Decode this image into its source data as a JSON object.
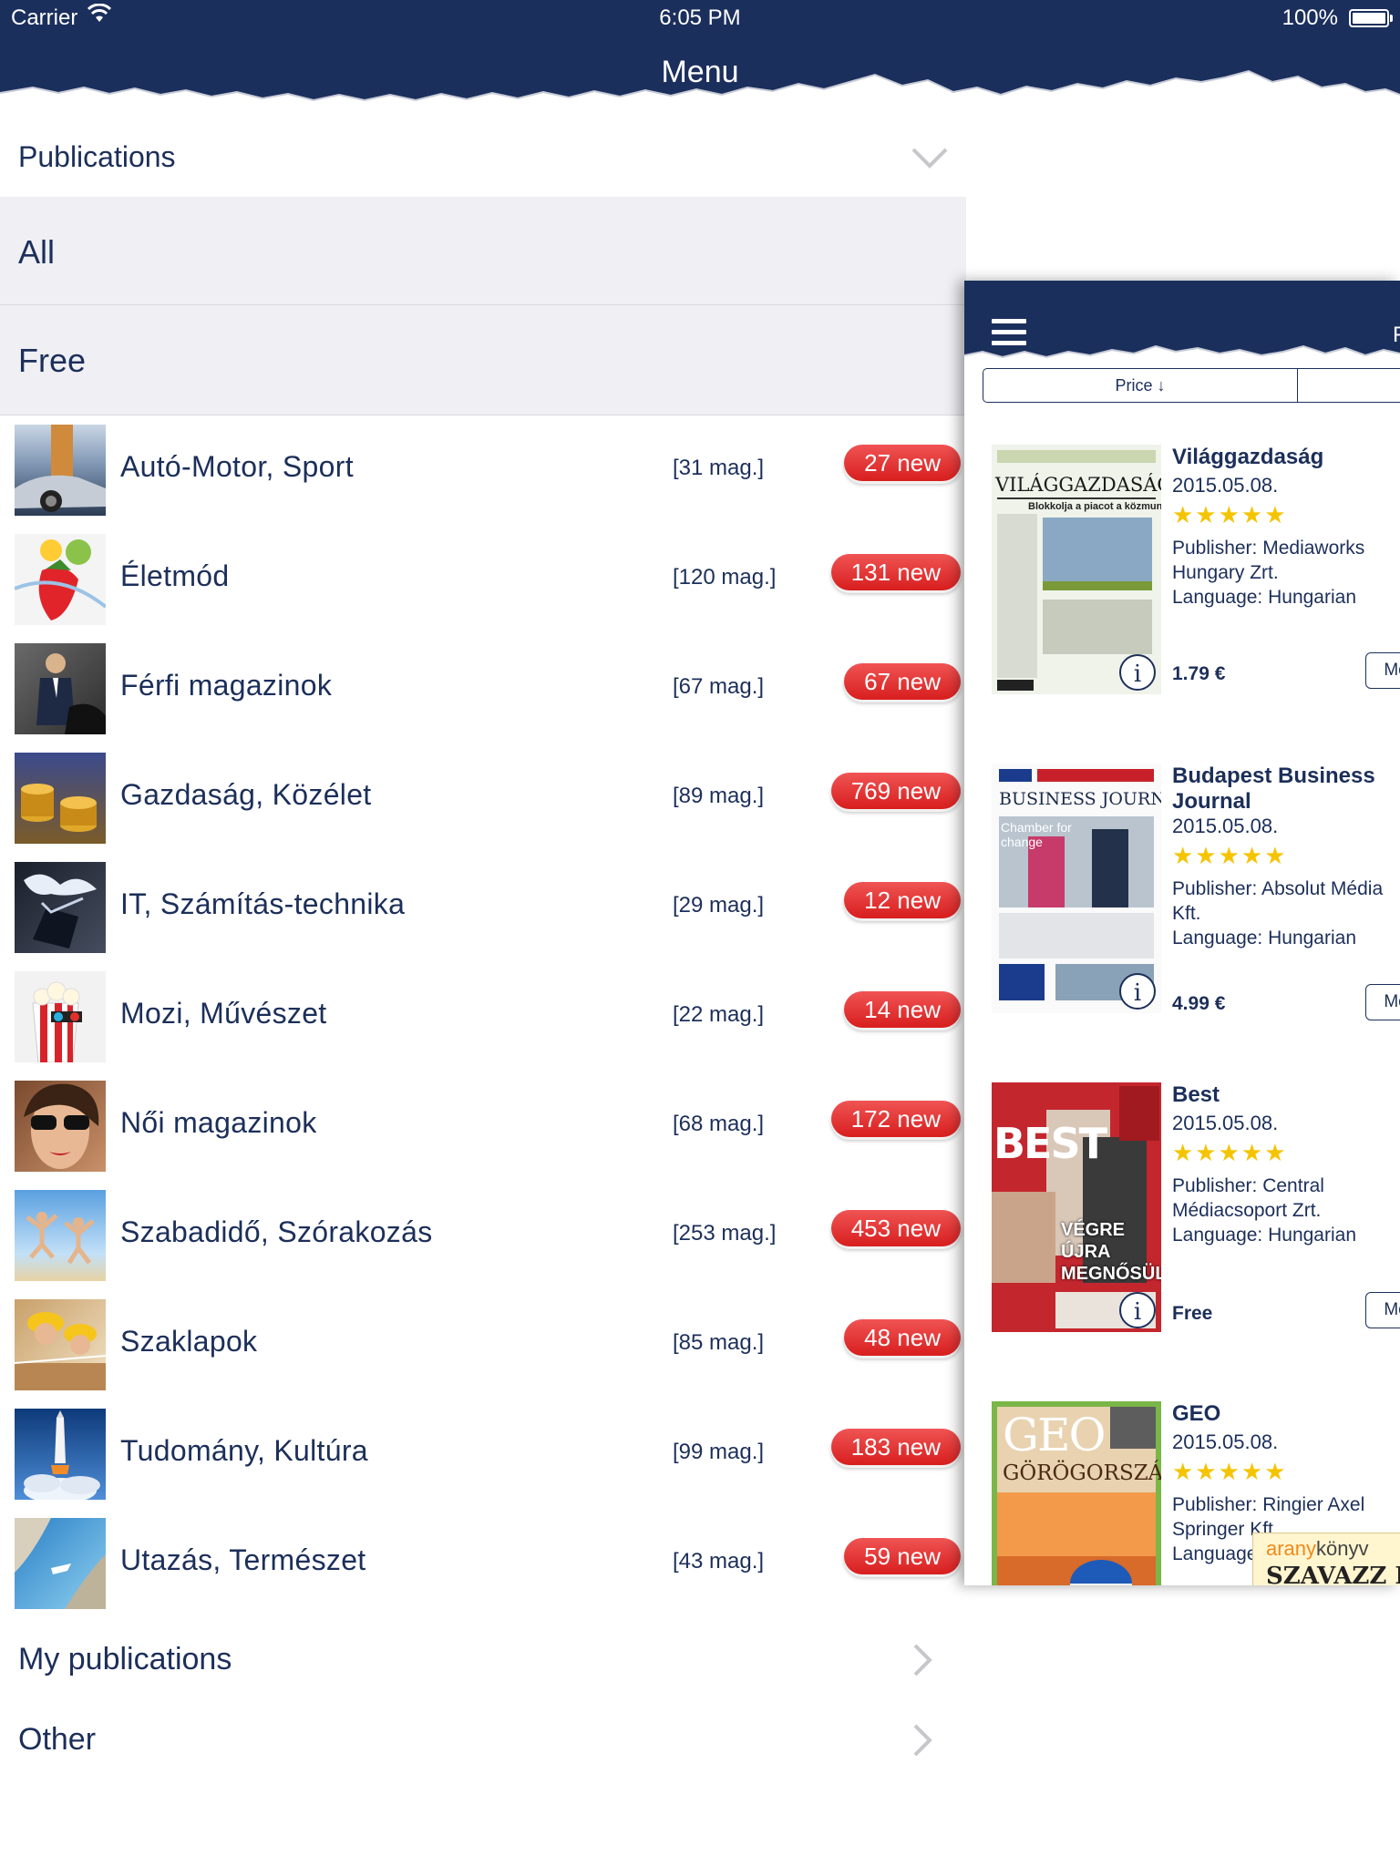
{
  "status_bar": {
    "carrier": "Carrier",
    "time": "6:05 PM",
    "battery": "100%"
  },
  "nav": {
    "title": "Menu"
  },
  "publications_section": {
    "title": "Publications"
  },
  "filters": [
    "All",
    "Free"
  ],
  "categories": [
    {
      "name": "Autó-Motor, Sport",
      "count": "[31 mag.]",
      "badge": "27 new"
    },
    {
      "name": "Életmód",
      "count": "[120 mag.]",
      "badge": "131 new"
    },
    {
      "name": "Férfi magazinok",
      "count": "[67 mag.]",
      "badge": "67 new"
    },
    {
      "name": "Gazdaság, Közélet",
      "count": "[89 mag.]",
      "badge": "769 new"
    },
    {
      "name": "IT, Számítás-technika",
      "count": "[29 mag.]",
      "badge": "12 new"
    },
    {
      "name": "Mozi, Művészet",
      "count": "[22 mag.]",
      "badge": "14 new"
    },
    {
      "name": "Női magazinok",
      "count": "[68 mag.]",
      "badge": "172 new"
    },
    {
      "name": "Szabadidő, Szórakozás",
      "count": "[253 mag.]",
      "badge": "453 new"
    },
    {
      "name": "Szaklapok",
      "count": "[85 mag.]",
      "badge": "48 new"
    },
    {
      "name": "Tudomány, Kultúra",
      "count": "[99 mag.]",
      "badge": "183 new"
    },
    {
      "name": "Utazás, Természet",
      "count": "[43 mag.]",
      "badge": "59 new"
    }
  ],
  "bottom_items": [
    "My publications",
    "Other"
  ],
  "panel": {
    "title_fragment": "F",
    "sort_label": "Price ↓",
    "more_label": "More",
    "items": [
      {
        "title": "Világgazdaság",
        "date": "2015.05.08.",
        "stars": "★★★★★",
        "publisher": "Publisher: Mediaworks Hungary Zrt.",
        "language": "Language: Hungarian",
        "price": "1.79 €",
        "cover": {
          "masthead": "VILÁGGAZDASÁG",
          "headline": "Blokkolja a piacot a közmunka"
        }
      },
      {
        "title": "Budapest Business Journal",
        "date": "2015.05.08.",
        "stars": "★★★★★",
        "publisher": "Publisher: Absolut Média Kft.",
        "language": "Language: Hungarian",
        "price": "4.99 €",
        "cover": {
          "masthead": "BUSINESS JOURNAL",
          "headline": "Chamber for change"
        }
      },
      {
        "title": "Best",
        "date": "2015.05.08.",
        "stars": "★★★★★",
        "publisher": "Publisher: Central Médiacsoport Zrt.",
        "language": "Language: Hungarian",
        "price": "Free",
        "cover": {
          "masthead": "BEST",
          "headline": "VÉGRE ÚJRA MEGNŐSÜL!"
        }
      },
      {
        "title": "GEO",
        "date": "2015.05.08.",
        "stars": "★★★★★",
        "publisher": "Publisher: Ringier Axel Springer Kft.",
        "language": "Language: Hungarian",
        "price": "",
        "cover": {
          "masthead": "GEO",
          "headline": "GÖRÖGORSZÁG"
        }
      }
    ]
  },
  "ad": {
    "brand_a": "arany",
    "brand_b": "könyv",
    "cta": "SZAVAZZ É"
  },
  "colors": {
    "navy": "#1b2f5c",
    "badge_red": "#e23232",
    "star": "#f5c400",
    "cover_green": "#7ab648"
  }
}
